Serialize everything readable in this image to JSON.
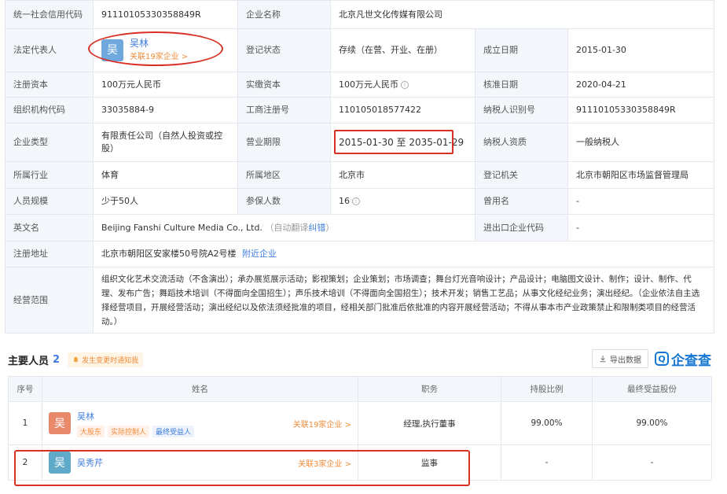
{
  "info": {
    "credit_code_label": "统一社会信用代码",
    "credit_code": "91110105330358849R",
    "company_name_label": "企业名称",
    "company_name": "北京凡世文化传媒有限公司",
    "legal_rep_label": "法定代表人",
    "legal_rep": {
      "avatar": "吴",
      "name": "吴林",
      "related": "关联19家企业 >"
    },
    "reg_status_label": "登记状态",
    "reg_status": "存续（在营、开业、在册）",
    "founded_label": "成立日期",
    "founded": "2015-01-30",
    "reg_capital_label": "注册资本",
    "reg_capital": "100万元人民币",
    "paid_capital_label": "实缴资本",
    "paid_capital": "100万元人民币",
    "approved_label": "核准日期",
    "approved": "2020-04-21",
    "org_code_label": "组织机构代码",
    "org_code": "33035884-9",
    "biz_reg_no_label": "工商注册号",
    "biz_reg_no": "110105018577422",
    "taxpayer_id_label": "纳税人识别号",
    "taxpayer_id": "91110105330358849R",
    "company_type_label": "企业类型",
    "company_type": "有限责任公司（自然人投资或控股）",
    "biz_term_label": "营业期限",
    "biz_term": "2015-01-30 至 2035-01-29",
    "taxpayer_qual_label": "纳税人资质",
    "taxpayer_qual": "一般纳税人",
    "industry_label": "所属行业",
    "industry": "体育",
    "region_label": "所属地区",
    "region": "北京市",
    "authority_label": "登记机关",
    "authority": "北京市朝阳区市场监督管理局",
    "staff_size_label": "人员规模",
    "staff_size": "少于50人",
    "insured_label": "参保人数",
    "insured": "16",
    "former_name_label": "曾用名",
    "former_name": "-",
    "english_name_label": "英文名",
    "english_name": "Beijing Fanshi Culture Media Co., Ltd.",
    "auto_translate": "（自动翻译",
    "correct_link": "纠错",
    "auto_translate_end": "）",
    "import_export_label": "进出口企业代码",
    "import_export": "-",
    "address_label": "注册地址",
    "address": "北京市朝阳区安家楼50号院A2号楼",
    "nearby_link": "附近企业",
    "scope_label": "经营范围",
    "scope": "组织文化艺术交流活动（不含演出）；承办展览展示活动；影视策划；企业策划；市场调查；舞台灯光音响设计；产品设计；电脑图文设计、制作；设计、制作、代理、发布广告；舞蹈技术培训（不得面向全国招生）；声乐技术培训（不得面向全国招生）；技术开发；销售工艺品；从事文化经纪业务；演出经纪。（企业依法自主选择经营项目，开展经营活动；演出经纪以及依法须经批准的项目，经相关部门批准后依批准的内容开展经营活动；不得从事本市产业政策禁止和限制类项目的经营活动。）"
  },
  "personnel": {
    "title": "主要人员",
    "count": "2",
    "notice": "发生变更时通知我",
    "export_label": "导出数据",
    "brand": "企查查",
    "brand_logo": "Q",
    "columns": [
      "序号",
      "姓名",
      "职务",
      "持股比例",
      "最终受益股份"
    ],
    "rows": [
      {
        "no": "1",
        "avatar": "吴",
        "name": "吴林",
        "tags": [
          "大股东",
          "实际控制人",
          "最终受益人"
        ],
        "related": "关联19家企业 >",
        "position": "经理,执行董事",
        "share": "99.00%",
        "benefit": "99.00%"
      },
      {
        "no": "2",
        "avatar": "吴",
        "name": "吴秀芹",
        "related": "关联3家企业 >",
        "position": "监事",
        "share": "-",
        "benefit": "-"
      }
    ]
  },
  "colors": {
    "accent": "#3f7de0",
    "highlight_red": "#d93025",
    "orange": "#f08c3a"
  }
}
